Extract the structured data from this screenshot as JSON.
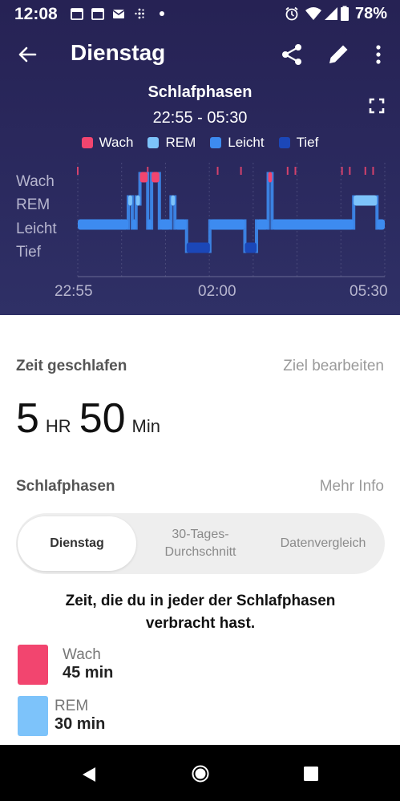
{
  "status_bar": {
    "time": "12:08",
    "battery": "78%"
  },
  "app_bar": {
    "title": "Dienstag"
  },
  "chart_header": {
    "title": "Schlafphasen",
    "range": "22:55 - 05:30"
  },
  "colors": {
    "wach": "#f2456f",
    "rem": "#7dc3fa",
    "leicht": "#3d8bf0",
    "tief": "#1b47b8"
  },
  "chart_data": {
    "type": "area",
    "legend": [
      "Wach",
      "REM",
      "Leicht",
      "Tief"
    ],
    "y_categories": [
      "Wach",
      "REM",
      "Leicht",
      "Tief"
    ],
    "x_ticks": [
      "22:55",
      "02:00",
      "05:30"
    ],
    "x_range": [
      "22:55",
      "05:30"
    ],
    "segments": [
      {
        "start": "22:55",
        "end": "00:00",
        "stage": "Leicht"
      },
      {
        "start": "00:00",
        "end": "00:05",
        "stage": "REM"
      },
      {
        "start": "00:05",
        "end": "00:10",
        "stage": "Leicht"
      },
      {
        "start": "00:10",
        "end": "00:15",
        "stage": "REM"
      },
      {
        "start": "00:15",
        "end": "00:25",
        "stage": "Wach"
      },
      {
        "start": "00:25",
        "end": "00:30",
        "stage": "Leicht"
      },
      {
        "start": "00:30",
        "end": "00:40",
        "stage": "Wach"
      },
      {
        "start": "00:40",
        "end": "00:55",
        "stage": "Leicht"
      },
      {
        "start": "00:55",
        "end": "01:00",
        "stage": "REM"
      },
      {
        "start": "01:00",
        "end": "01:15",
        "stage": "Leicht"
      },
      {
        "start": "01:15",
        "end": "01:45",
        "stage": "Tief"
      },
      {
        "start": "01:45",
        "end": "02:30",
        "stage": "Leicht"
      },
      {
        "start": "02:30",
        "end": "02:45",
        "stage": "Tief"
      },
      {
        "start": "02:45",
        "end": "03:00",
        "stage": "Leicht"
      },
      {
        "start": "03:00",
        "end": "03:05",
        "stage": "Wach"
      },
      {
        "start": "03:05",
        "end": "04:50",
        "stage": "Leicht"
      },
      {
        "start": "04:50",
        "end": "05:20",
        "stage": "REM"
      },
      {
        "start": "05:20",
        "end": "05:30",
        "stage": "Leicht"
      }
    ],
    "wake_ticks": [
      "22:55",
      "00:25",
      "01:55",
      "02:25",
      "03:25",
      "03:35",
      "04:35",
      "04:45",
      "05:05",
      "05:15"
    ]
  },
  "sleep_time": {
    "label": "Zeit geschlafen",
    "link": "Ziel bearbeiten",
    "hours": "5",
    "hours_unit": "HR",
    "minutes": "50",
    "minutes_unit": "Min"
  },
  "phases": {
    "label": "Schlafphasen",
    "link": "Mehr Info"
  },
  "segment_control": {
    "options": [
      "Dienstag",
      "30-Tages-\nDurchschnitt",
      "Datenvergleich"
    ],
    "selected": "Dienstag"
  },
  "description": "Zeit, die du in jeder der Schlafphasen verbracht hast.",
  "stages": [
    {
      "name": "Wach",
      "value": "45 min"
    },
    {
      "name": "REM",
      "value": "30 min"
    }
  ]
}
